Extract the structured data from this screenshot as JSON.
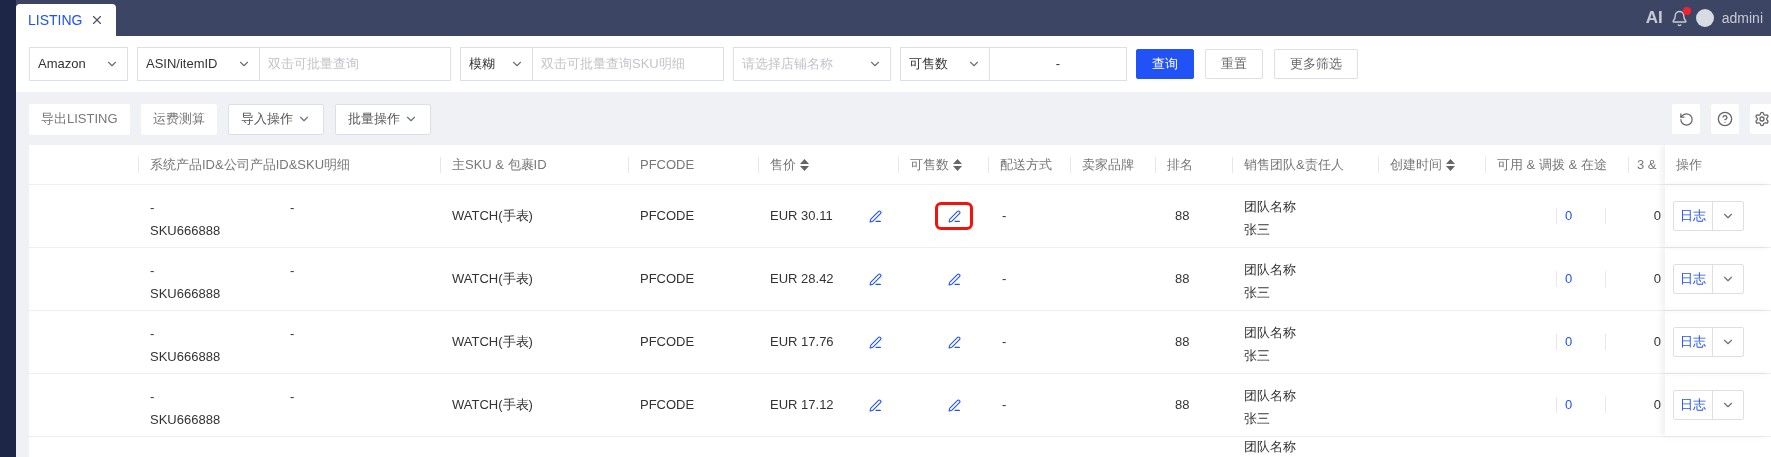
{
  "top_bar": {
    "tabs": [
      {
        "label": "LISTING",
        "selected": true
      }
    ],
    "ai_label": "AI",
    "notification_dot": true,
    "user": "admini"
  },
  "filters": {
    "platform": "Amazon",
    "id_type": "ASIN/itemID",
    "id_placeholder": "双击可批量查询",
    "match_mode": "模糊",
    "sku_placeholder": "双击可批量查询SKU明细",
    "store_placeholder": "请选择店铺名称",
    "qty_field": "可售数",
    "qty_range_separator": "-",
    "buttons": [
      {
        "label": "查询",
        "kind": "primary"
      },
      {
        "label": "重置",
        "kind": "default"
      },
      {
        "label": "更多筛选",
        "kind": "default"
      }
    ]
  },
  "toolbar": {
    "buttons": [
      {
        "label": "导出LISTING",
        "kind": "plain"
      },
      {
        "label": "运费测算",
        "kind": "plain"
      },
      {
        "label": "导入操作",
        "kind": "dropdown"
      },
      {
        "label": "批量操作",
        "kind": "dropdown"
      }
    ]
  },
  "table": {
    "columns": [
      {
        "label": "系统产品ID&公司产品ID&SKU明细",
        "sortable": false
      },
      {
        "label": "主SKU & 包裹ID",
        "sortable": false
      },
      {
        "label": "PFCODE",
        "sortable": false
      },
      {
        "label": "售价",
        "sortable": true
      },
      {
        "label": "可售数",
        "sortable": true
      },
      {
        "label": "配送方式",
        "sortable": false
      },
      {
        "label": "卖家品牌",
        "sortable": false
      },
      {
        "label": "排名",
        "sortable": false
      },
      {
        "label": "销售团队&责任人",
        "sortable": false
      },
      {
        "label": "创建时间",
        "sortable": true
      },
      {
        "label": "可用 & 调拨 & 在途",
        "sortable": false
      },
      {
        "label": "3 &",
        "sortable": false
      },
      {
        "label": "操作",
        "sortable": false
      }
    ],
    "rows": [
      {
        "system_id": "-",
        "company_id": "-",
        "sku": "SKU666888",
        "main_sku": "WATCH(手表)",
        "pfcode": "PFCODE",
        "price": "EUR 30.11",
        "stock_highlighted": true,
        "shipping": "-",
        "rank": "88",
        "team": "团队名称",
        "owner": "张三",
        "available": "0",
        "column_12": "0",
        "action": "日志"
      },
      {
        "system_id": "-",
        "company_id": "-",
        "sku": "SKU666888",
        "main_sku": "WATCH(手表)",
        "pfcode": "PFCODE",
        "price": "EUR 28.42",
        "stock_highlighted": false,
        "shipping": "-",
        "rank": "88",
        "team": "团队名称",
        "owner": "张三",
        "available": "0",
        "column_12": "0",
        "action": "日志"
      },
      {
        "system_id": "-",
        "company_id": "-",
        "sku": "SKU666888",
        "main_sku": "WATCH(手表)",
        "pfcode": "PFCODE",
        "price": "EUR 17.76",
        "stock_highlighted": false,
        "shipping": "-",
        "rank": "88",
        "team": "团队名称",
        "owner": "张三",
        "available": "0",
        "column_12": "0",
        "action": "日志"
      },
      {
        "system_id": "-",
        "company_id": "-",
        "sku": "SKU666888",
        "main_sku": "WATCH(手表)",
        "pfcode": "PFCODE",
        "price": "EUR 17.12",
        "stock_highlighted": false,
        "shipping": "-",
        "rank": "88",
        "team": "团队名称",
        "owner": "张三",
        "available": "0",
        "column_12": "0",
        "action": "日志"
      },
      {
        "team": "团队名称"
      }
    ]
  }
}
